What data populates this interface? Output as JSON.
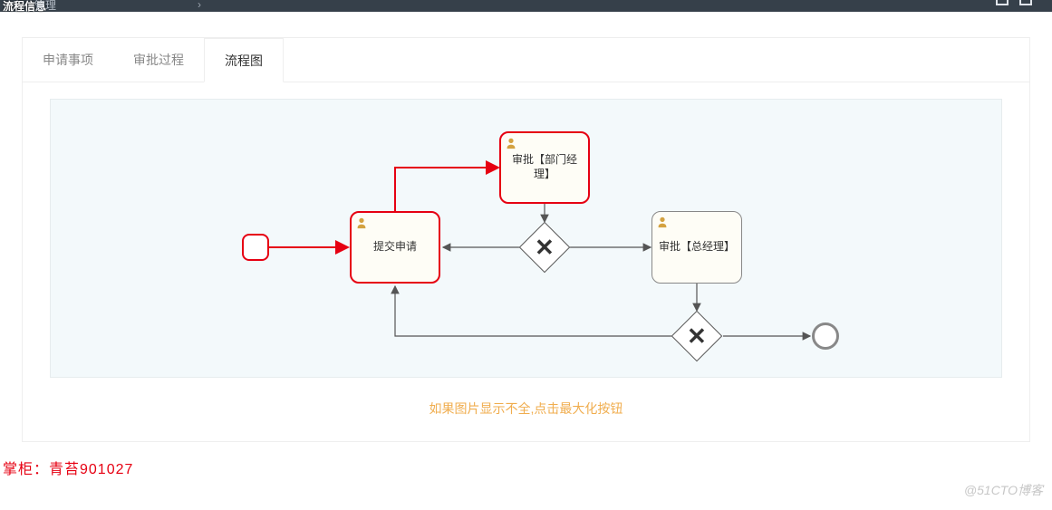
{
  "topbar": {
    "overlay_title": "流程信息",
    "submenu_label": "管理",
    "chevron": "›"
  },
  "tabs": {
    "items": [
      {
        "label": "申请事项",
        "active": false
      },
      {
        "label": "审批过程",
        "active": false
      },
      {
        "label": "流程图",
        "active": true
      }
    ]
  },
  "diagram": {
    "start_event": {
      "type": "startEvent",
      "highlight": true
    },
    "task_submit": {
      "label": "提交申请",
      "type": "userTask",
      "highlight": true
    },
    "task_dept_mgr": {
      "label": "审批【部门经理】",
      "type": "userTask",
      "highlight": true
    },
    "task_gen_mgr": {
      "label": "审批【总经理】",
      "type": "userTask",
      "highlight": false
    },
    "gateway1": {
      "type": "exclusiveGateway"
    },
    "gateway2": {
      "type": "exclusiveGateway"
    },
    "end_event": {
      "type": "endEvent"
    },
    "flows": [
      {
        "from": "start_event",
        "to": "task_submit",
        "highlight": true
      },
      {
        "from": "task_submit",
        "to": "task_dept_mgr",
        "highlight": true
      },
      {
        "from": "task_dept_mgr",
        "to": "gateway1",
        "highlight": false
      },
      {
        "from": "gateway1",
        "to": "task_gen_mgr",
        "highlight": false
      },
      {
        "from": "gateway1",
        "to": "task_submit",
        "highlight": false,
        "path": "return-top"
      },
      {
        "from": "task_gen_mgr",
        "to": "gateway2",
        "highlight": false
      },
      {
        "from": "gateway2",
        "to": "end_event",
        "highlight": false
      },
      {
        "from": "gateway2",
        "to": "task_submit",
        "highlight": false,
        "path": "return-bottom"
      }
    ]
  },
  "hint_text": "如果图片显示不全,点击最大化按钮",
  "owner_label": "掌柜：青苔901027",
  "watermark": "@51CTO博客",
  "colors": {
    "highlight": "#e60012",
    "normal_stroke": "#555555",
    "task_fill": "#fefdf6",
    "canvas_bg": "#f3f9fb",
    "hint": "#f0ad4e",
    "user_icon": "#d4a241"
  }
}
